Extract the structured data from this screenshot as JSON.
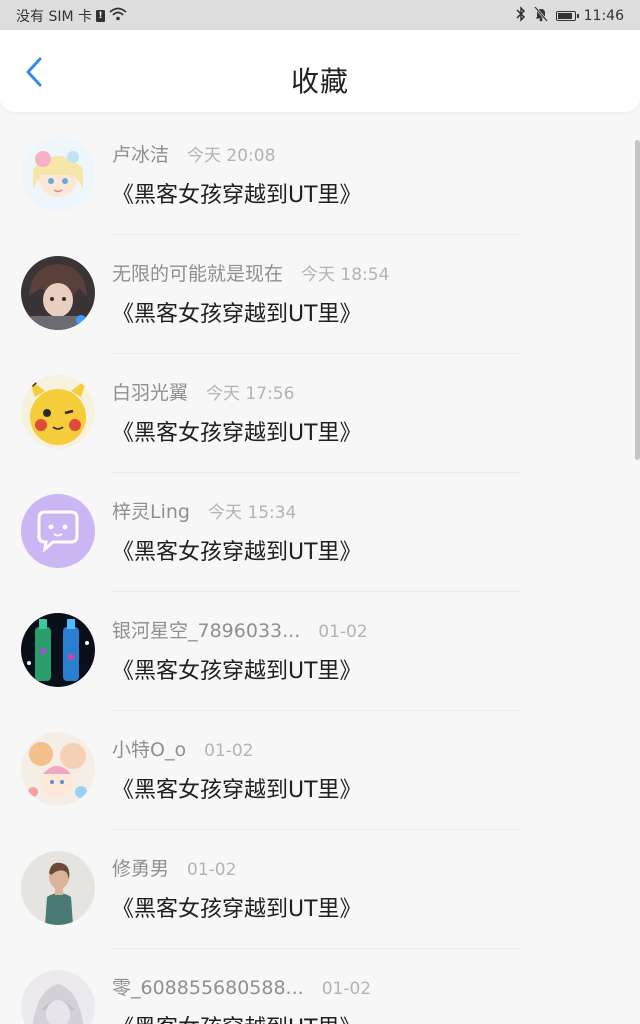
{
  "status_bar": {
    "carrier": "没有 SIM 卡",
    "sim_badge": "!",
    "time": "11:46",
    "icons": [
      "wifi-icon",
      "bluetooth-icon",
      "mute-bell-icon",
      "battery-icon"
    ]
  },
  "header": {
    "title": "收藏",
    "back_icon": "chevron-left-icon"
  },
  "colors": {
    "accent": "#2f8de4",
    "title_text": "#1f1f1f",
    "meta_text": "#8f8f8f",
    "time_text": "#b3b3b3",
    "background": "#f7f7f7"
  },
  "favorites": [
    {
      "user": "卢冰洁",
      "time": "今天 20:08",
      "title": "《黑客女孩穿越到UT里》"
    },
    {
      "user": "无限的可能就是现在",
      "time": "今天 18:54",
      "title": "《黑客女孩穿越到UT里》"
    },
    {
      "user": "白羽光翼",
      "time": "今天 17:56",
      "title": "《黑客女孩穿越到UT里》"
    },
    {
      "user": "梓灵Ling",
      "time": "今天 15:34",
      "title": "《黑客女孩穿越到UT里》"
    },
    {
      "user": "银河星空_7896033...",
      "time": "01-02",
      "title": "《黑客女孩穿越到UT里》"
    },
    {
      "user": "小特O_o",
      "time": "01-02",
      "title": "《黑客女孩穿越到UT里》"
    },
    {
      "user": "修勇男",
      "time": "01-02",
      "title": "《黑客女孩穿越到UT里》"
    },
    {
      "user": "零_608855680588...",
      "time": "01-02",
      "title": "《黑客女孩穿越到UT里》"
    }
  ]
}
